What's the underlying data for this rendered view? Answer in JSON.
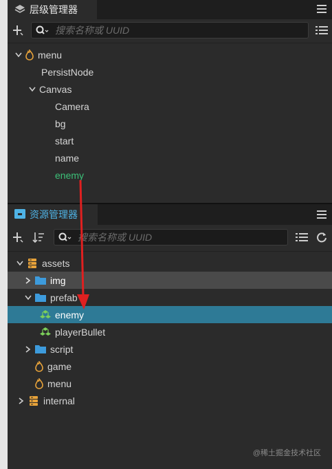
{
  "hierarchy": {
    "tab_label": "层级管理器",
    "search_placeholder": "搜索名称或 UUID",
    "nodes": [
      {
        "label": "menu"
      },
      {
        "label": "PersistNode"
      },
      {
        "label": "Canvas"
      },
      {
        "label": "Camera"
      },
      {
        "label": "bg"
      },
      {
        "label": "start"
      },
      {
        "label": "name"
      },
      {
        "label": "enemy"
      }
    ]
  },
  "assets": {
    "tab_label": "资源管理器",
    "search_placeholder": "搜索名称或 UUID",
    "items": [
      {
        "label": "assets"
      },
      {
        "label": "img"
      },
      {
        "label": "prefab"
      },
      {
        "label": "enemy"
      },
      {
        "label": "playerBullet"
      },
      {
        "label": "script"
      },
      {
        "label": "game"
      },
      {
        "label": "menu"
      },
      {
        "label": "internal"
      }
    ]
  },
  "watermark": "@稀土掘金技术社区",
  "colors": {
    "panel_bg": "#2b2b2b",
    "selection_blue": "#2e7a96",
    "selection_gray": "#4a4a4a",
    "node_highlight": "#3cc078",
    "annotation_arrow": "#e02020",
    "asset_tab_text": "#4fb3e6"
  }
}
